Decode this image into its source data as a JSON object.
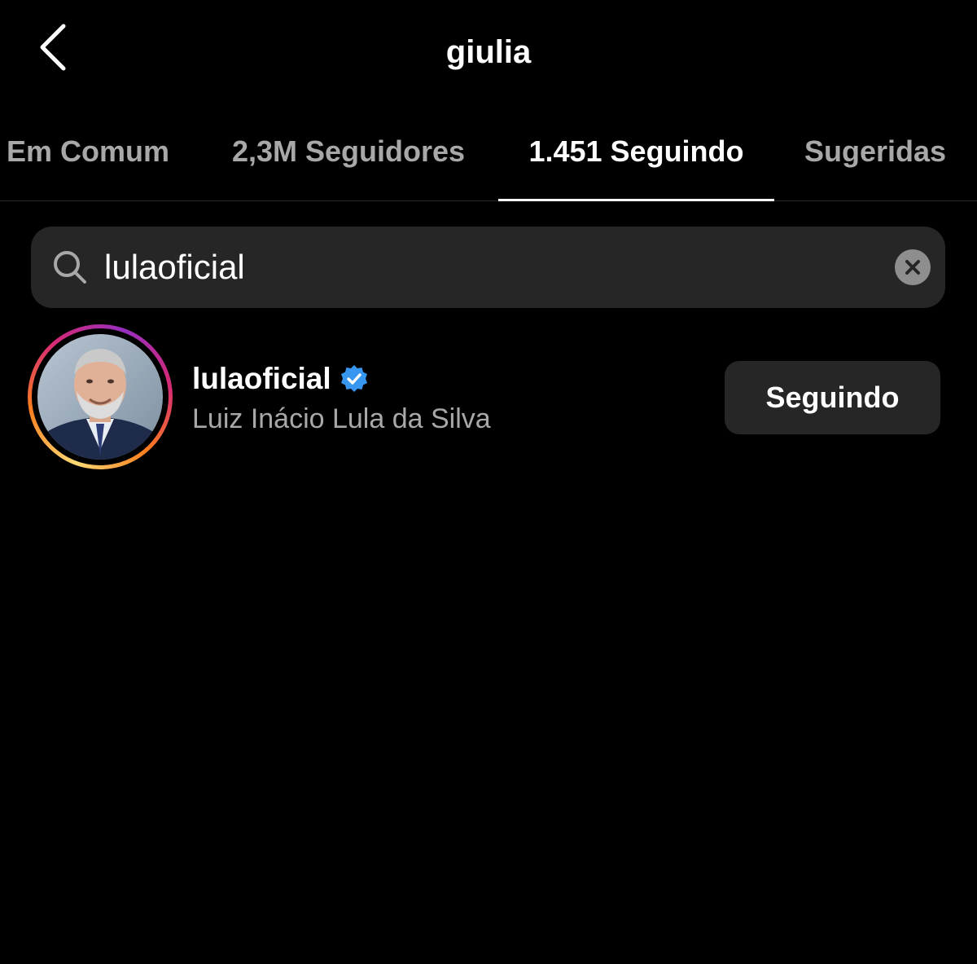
{
  "header": {
    "title": "giulia",
    "back_icon": "chevron-left-icon"
  },
  "tabs": [
    {
      "label": "Em Comum",
      "active": false
    },
    {
      "label": "2,3M Seguidores",
      "active": false
    },
    {
      "label": "1.451 Seguindo",
      "active": true
    },
    {
      "label": "Sugeridas",
      "active": false
    }
  ],
  "search": {
    "value": "lulaoficial",
    "icon": "search-icon",
    "clear_icon": "clear-icon"
  },
  "results": [
    {
      "username": "lulaoficial",
      "verified": true,
      "full_name": "Luiz Inácio Lula da Silva",
      "button_label": "Seguindo",
      "has_story_ring": true
    }
  ],
  "colors": {
    "background": "#000000",
    "surface": "#262626",
    "muted_text": "#a8a8a8",
    "verified_blue": "#3797f0"
  }
}
